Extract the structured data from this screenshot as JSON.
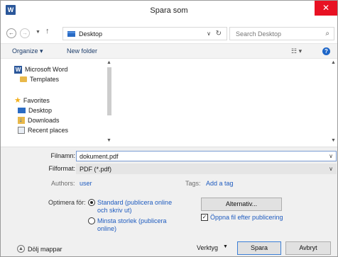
{
  "window": {
    "app_icon": "W",
    "title": "Spara som",
    "close_icon": "✕"
  },
  "address": {
    "path": "Desktop",
    "search_placeholder": "Search Desktop"
  },
  "toolbar": {
    "organize": "Organize ▾",
    "new_folder": "New folder",
    "help": "?"
  },
  "navpane": {
    "items": [
      {
        "label": "Microsoft Word",
        "icon": "word-icon"
      },
      {
        "label": "Templates",
        "icon": "folder-icon"
      },
      {
        "label": "Favorites",
        "icon": "star-icon"
      },
      {
        "label": "Desktop",
        "icon": "desktop-icon"
      },
      {
        "label": "Downloads",
        "icon": "downloads-icon"
      },
      {
        "label": "Recent places",
        "icon": "recent-places-icon"
      }
    ]
  },
  "form": {
    "filename_label": "Filnamn:",
    "filename_value": "dokument.pdf",
    "format_label": "Filformat:",
    "format_value": "PDF (*.pdf)",
    "authors_label": "Authors:",
    "authors_value": "user",
    "tags_label": "Tags:",
    "tags_value": "Add a tag",
    "optimize_label": "Optimera för:",
    "opt_standard": "Standard (publicera online och skriv ut)",
    "opt_minimum": "Minsta storlek (publicera online)",
    "options_button": "Alternativ...",
    "open_after": "Öppna fil efter publicering"
  },
  "footer": {
    "hide_folders": "Dölj mappar",
    "tools": "Verktyg",
    "save": "Spara",
    "cancel": "Avbryt"
  },
  "colors": {
    "accent": "#1e5bbf",
    "close": "#e81123",
    "word": "#2b579a"
  }
}
